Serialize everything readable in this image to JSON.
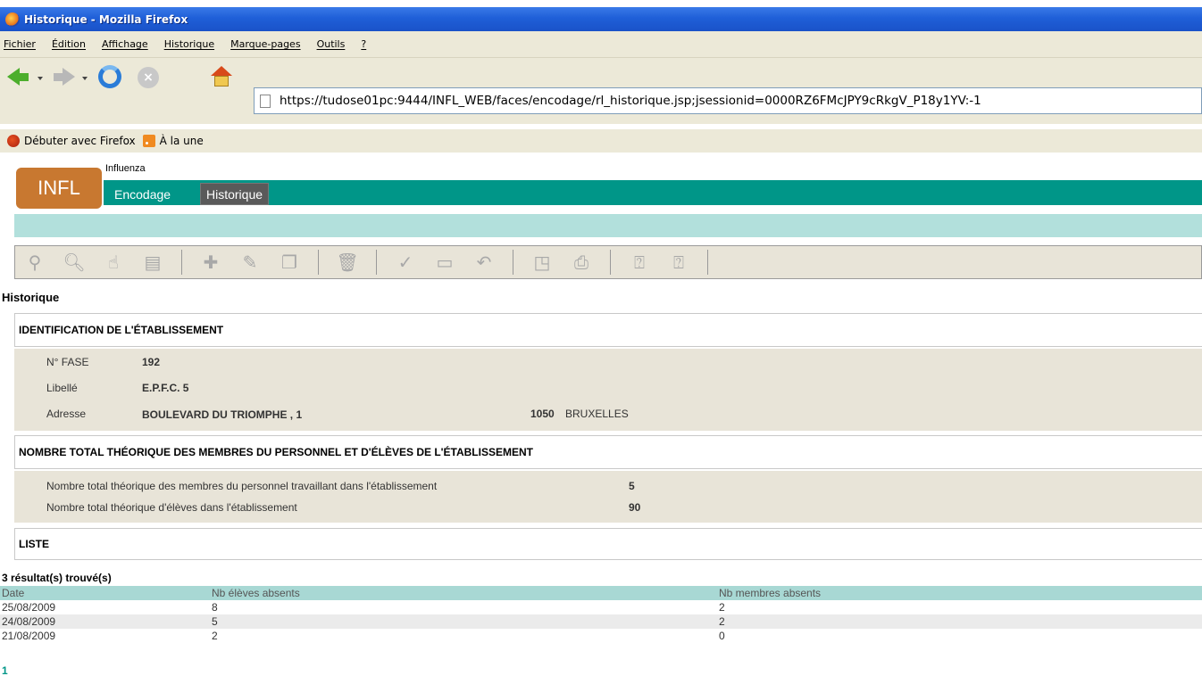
{
  "window": {
    "title": "Historique - Mozilla Firefox"
  },
  "menu": [
    "Fichier",
    "Édition",
    "Affichage",
    "Historique",
    "Marque-pages",
    "Outils",
    "?"
  ],
  "nav": {
    "url": "https://tudose01pc:9444/INFL_WEB/faces/encodage/rl_historique.jsp;jsessionid=0000RZ6FMcJPY9cRkgV_P18y1YV:-1"
  },
  "bookmarks": {
    "item1": "Débuter avec Firefox",
    "item2": "À la une"
  },
  "app": {
    "logo": "INFL",
    "subtitle": "Influenza",
    "tabs": {
      "encodage": "Encodage",
      "historique": "Historique"
    }
  },
  "toolbar": {
    "icons": [
      "binoculars-icon",
      "search-icon",
      "hand-icon",
      "document-icon",
      "add-icon",
      "edit-pencil-icon",
      "copy-icon",
      "delete-trash-icon",
      "validate-check-icon",
      "save-disk-icon",
      "undo-icon",
      "print-preview-icon",
      "print-icon",
      "help-icon",
      "help-page-icon"
    ]
  },
  "page": {
    "title": "Historique"
  },
  "identification": {
    "header": "IDENTIFICATION DE L'ÉTABLISSEMENT",
    "fase_label": "N° FASE",
    "fase_value": "192",
    "libelle_label": "Libellé",
    "libelle_value": "E.P.F.C. 5",
    "adresse_label": "Adresse",
    "adresse_value": "BOULEVARD DU TRIOMPHE , 1",
    "postal_code": "1050",
    "city": "BRUXELLES"
  },
  "nombre": {
    "header": "NOMBRE TOTAL THÉORIQUE DES MEMBRES DU PERSONNEL ET D'ÉLÈVES DE L'ÉTABLISSEMENT",
    "personnel_label": "Nombre total théorique des membres du personnel travaillant dans l'établissement",
    "personnel_value": "5",
    "eleves_label": "Nombre total théorique d'élèves dans l'établissement",
    "eleves_value": "90"
  },
  "liste": {
    "header": "LISTE",
    "result_count": "3  résultat(s) trouvé(s)",
    "columns": [
      "Date",
      "Nb élèves absents",
      "Nb membres absents"
    ],
    "rows": [
      [
        "25/08/2009",
        "8",
        "2"
      ],
      [
        "24/08/2009",
        "5",
        "2"
      ],
      [
        "21/08/2009",
        "2",
        "0"
      ]
    ],
    "page": "1"
  }
}
